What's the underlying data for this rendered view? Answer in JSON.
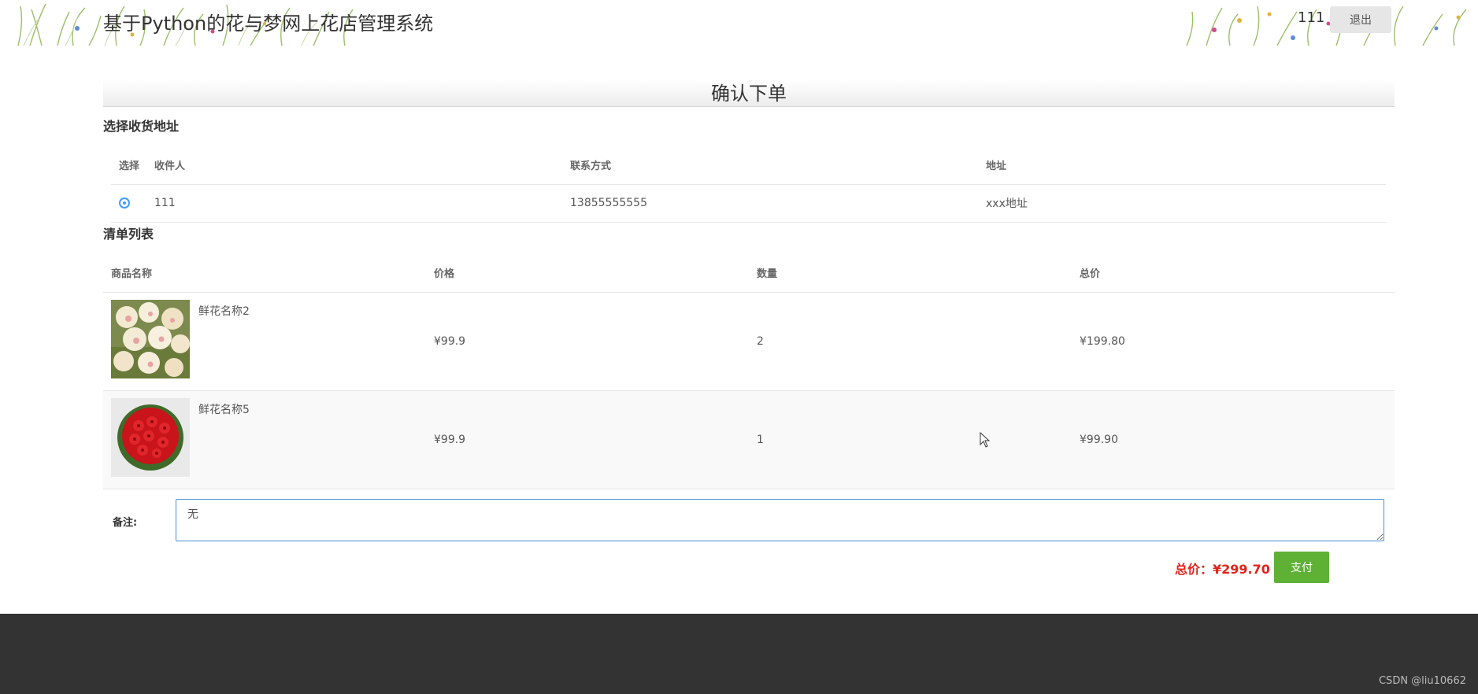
{
  "header": {
    "site_title": "基于Python的花与梦网上花店管理系统",
    "username": "111",
    "logout_label": "退出"
  },
  "page_title": "确认下单",
  "address_section": {
    "label": "选择收货地址",
    "columns": [
      "选择",
      "收件人",
      "联系方式",
      "地址"
    ],
    "rows": [
      {
        "selected": true,
        "recipient": "111",
        "phone": "13855555555",
        "address": "xxx地址"
      }
    ]
  },
  "items_section": {
    "label": "清单列表",
    "columns": [
      "商品名称",
      "价格",
      "数量",
      "总价"
    ],
    "rows": [
      {
        "name": "鲜花名称2",
        "price": "¥99.9",
        "quantity": "2",
        "subtotal": "¥199.80",
        "image": "white-rose-bouquet"
      },
      {
        "name": "鲜花名称5",
        "price": "¥99.9",
        "quantity": "1",
        "subtotal": "¥99.90",
        "image": "red-rose-bouquet"
      }
    ]
  },
  "remark": {
    "label": "备注:",
    "value": "无"
  },
  "total": {
    "text": "总价：¥299.70"
  },
  "pay_label": "支付",
  "footer": {
    "watermark": "CSDN @liu10662"
  },
  "colors": {
    "accent_green": "#5fb136",
    "total_red": "#e2231a",
    "radio_blue": "#3d9df5",
    "footer_bg": "#333333"
  }
}
